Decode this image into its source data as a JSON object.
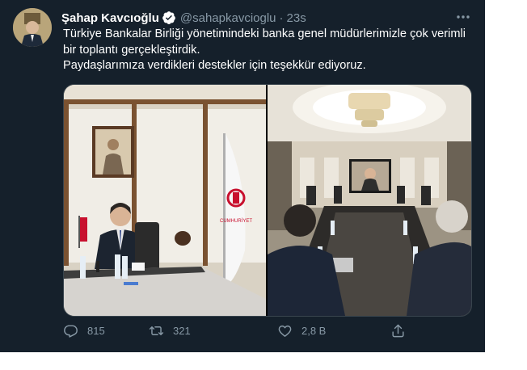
{
  "tweet": {
    "display_name": "Şahap Kavcıoğlu",
    "handle": "@sahapkavcioglu",
    "separator": "·",
    "time": "23s",
    "text_line_1": "Türkiye Bankalar Birliği yönetimindeki banka genel müdürlerimizle çok verimli bir toplantı gerçekleştirdik.",
    "text_line_2": "Paydaşlarımıza verdikleri destekler için teşekkür ediyoruz.",
    "verified": true,
    "icons": {
      "avatar": "profile-photo",
      "verified": "verified-badge-icon",
      "more": "more-dots-icon",
      "reply": "reply-icon",
      "retweet": "retweet-icon",
      "like": "heart-icon",
      "share": "share-icon"
    },
    "media": {
      "left_photo": "meeting-room-portrait",
      "right_photo": "conference-room-video-call",
      "flag_text": "CUMHURİYET BANKASI"
    },
    "counts": {
      "replies": "815",
      "retweets": "321",
      "likes": "2,8 B"
    }
  },
  "colors": {
    "background": "#15202b",
    "text": "#ffffff",
    "secondary": "#8899a6",
    "verified": "#1da1f2"
  }
}
